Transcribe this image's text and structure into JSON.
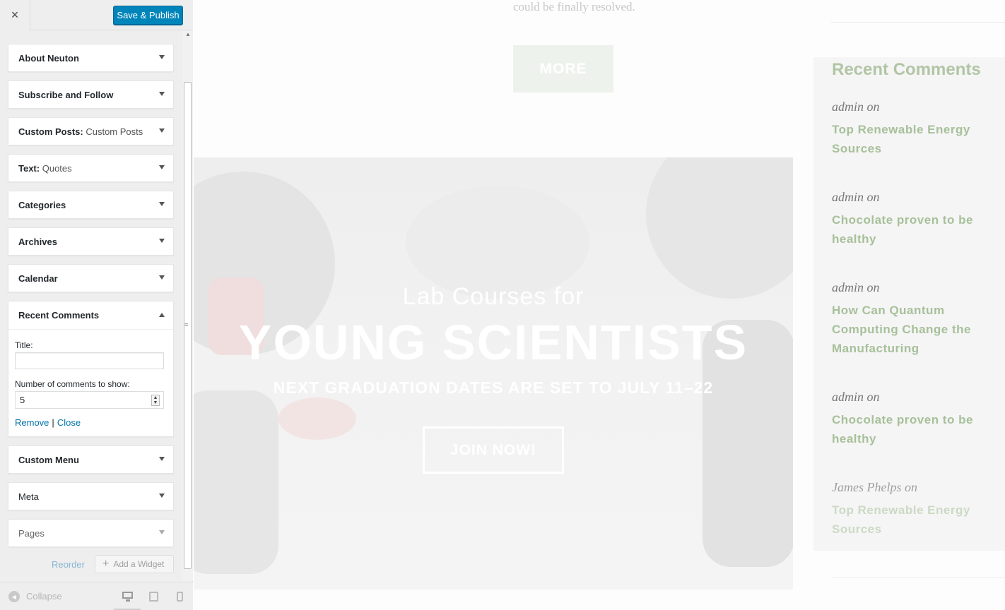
{
  "customizer": {
    "close_label": "×",
    "save_label": "Save & Publish",
    "widgets": [
      {
        "title": "About Neuton",
        "sub": ""
      },
      {
        "title": "Subscribe and Follow",
        "sub": ""
      },
      {
        "title": "Custom Posts:",
        "sub": " Custom Posts"
      },
      {
        "title": "Text:",
        "sub": " Quotes"
      },
      {
        "title": "Categories",
        "sub": ""
      },
      {
        "title": "Archives",
        "sub": ""
      },
      {
        "title": "Calendar",
        "sub": ""
      }
    ],
    "open_widget": {
      "title": "Recent Comments",
      "title_label": "Title:",
      "title_value": "",
      "count_label": "Number of comments to show:",
      "count_value": "5",
      "remove_label": "Remove",
      "separator": "|",
      "close_label": "Close"
    },
    "widgets_after": [
      {
        "title": "Custom Menu"
      },
      {
        "title": "Meta"
      },
      {
        "title": "Pages"
      }
    ],
    "reorder_label": "Reorder",
    "add_widget_label": "Add a Widget",
    "collapse_label": "Collapse",
    "accent_color": "#0085ba"
  },
  "preview": {
    "intro_text": "could be finally resolved.",
    "more_label": "MORE",
    "hero": {
      "line1": "Lab Courses for",
      "line2": "YOUNG SCIENTISTS",
      "line3": "NEXT GRADUATION DATES ARE SET TO JULY 11–22",
      "button": "JOIN NOW!"
    },
    "recent_comments": {
      "title": "Recent Comments",
      "items": [
        {
          "author": "admin on",
          "post": "Top Renewable Energy Sources"
        },
        {
          "author": "admin on",
          "post": "Chocolate proven to be healthy"
        },
        {
          "author": "admin on",
          "post": "How Can Quantum Computing Change the Manufacturing"
        },
        {
          "author": "admin on",
          "post": "Chocolate proven to be healthy"
        },
        {
          "author": "James Phelps on",
          "post": "Top Renewable Energy Sources"
        }
      ]
    }
  }
}
